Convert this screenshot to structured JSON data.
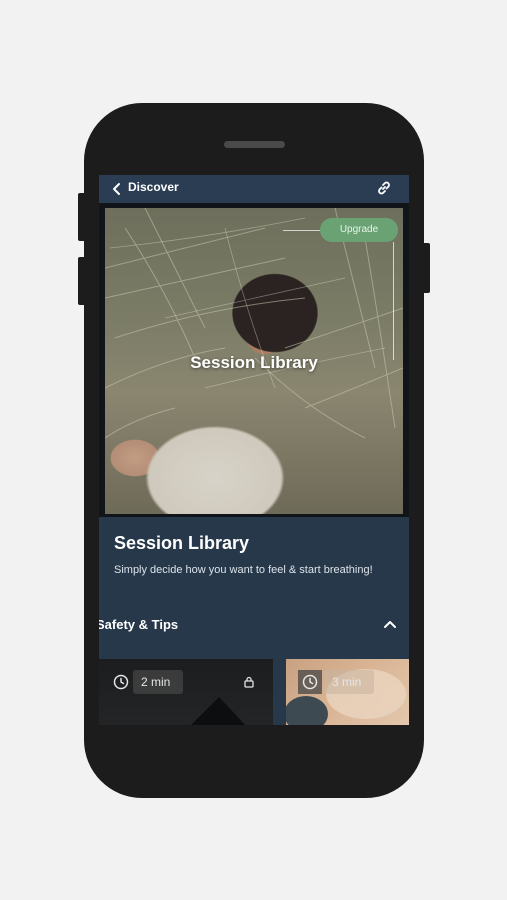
{
  "topbar": {
    "back_icon": "chevron-left-icon",
    "title": "Discover",
    "share_icon": "link-icon"
  },
  "hero": {
    "title": "Session Library",
    "upgrade_label": "Upgrade"
  },
  "info": {
    "title": "Session Library",
    "description": "Simply decide how you want to feel & start breathing!"
  },
  "section": {
    "title": "Safety & Tips",
    "toggle_icon": "chevron-up-icon"
  },
  "cards": [
    {
      "duration": "2 min",
      "locked": true,
      "icon": "clock-icon"
    },
    {
      "duration": "3 min",
      "locked": false,
      "icon": "clock-icon"
    }
  ],
  "colors": {
    "screen_bg": "#27384a",
    "topbar_bg": "#2a3d52",
    "accent_green": "#6aa274",
    "phone_frame": "#1c1c1c",
    "page_bg": "#f2f2f2"
  }
}
